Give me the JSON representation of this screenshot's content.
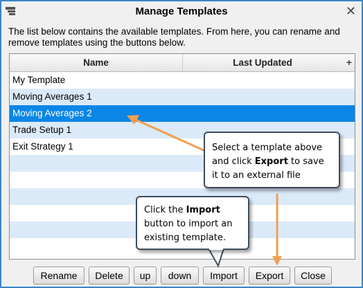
{
  "window": {
    "title": "Manage Templates"
  },
  "description": "The list below contains the available templates.  From here, you can rename and remove templates using the buttons below.",
  "table": {
    "columns": [
      "Name",
      "Last Updated"
    ],
    "add_column_glyph": "+",
    "rows": [
      {
        "name": "My Template",
        "last_updated": "",
        "selected": false
      },
      {
        "name": "Moving Averages 1",
        "last_updated": "",
        "selected": false
      },
      {
        "name": "Moving Averages 2",
        "last_updated": "",
        "selected": true
      },
      {
        "name": "Trade Setup 1",
        "last_updated": "",
        "selected": false
      },
      {
        "name": "Exit Strategy 1",
        "last_updated": "",
        "selected": false
      }
    ],
    "selection_color": "#0a86e6",
    "alt_row_color": "#dbeaf9"
  },
  "buttons": {
    "rename": "Rename",
    "delete": "Delete",
    "up": "up",
    "down": "down",
    "import": "Import",
    "export": "Export",
    "close": "Close"
  },
  "callouts": {
    "export_tip": {
      "pre": "Select a template above and click ",
      "bold": "Export",
      "post": " to save it to an external file"
    },
    "import_tip": {
      "pre": "Click the ",
      "bold": "Import",
      "post": " button to import an existing template."
    }
  },
  "icons": {
    "app": "window-menu-icon",
    "close": "close-icon"
  },
  "colors": {
    "window_border": "#3a86c8",
    "arrow": "#f0a050",
    "callout_border": "#3d4c5c"
  }
}
